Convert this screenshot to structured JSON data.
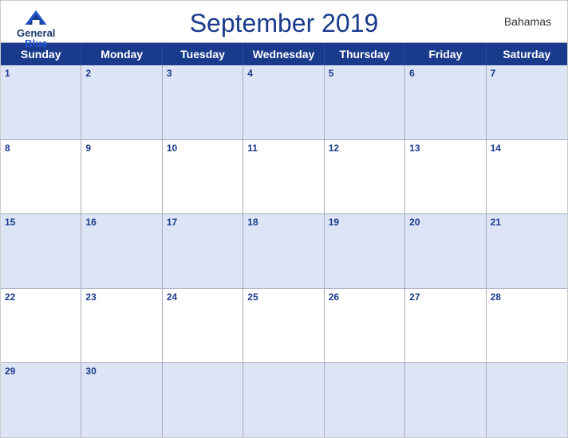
{
  "header": {
    "logo_general": "General",
    "logo_blue": "Blue",
    "title": "September 2019",
    "country": "Bahamas"
  },
  "days_of_week": [
    "Sunday",
    "Monday",
    "Tuesday",
    "Wednesday",
    "Thursday",
    "Friday",
    "Saturday"
  ],
  "weeks": [
    [
      1,
      2,
      3,
      4,
      5,
      6,
      7
    ],
    [
      8,
      9,
      10,
      11,
      12,
      13,
      14
    ],
    [
      15,
      16,
      17,
      18,
      19,
      20,
      21
    ],
    [
      22,
      23,
      24,
      25,
      26,
      27,
      28
    ],
    [
      29,
      30,
      null,
      null,
      null,
      null,
      null
    ]
  ]
}
